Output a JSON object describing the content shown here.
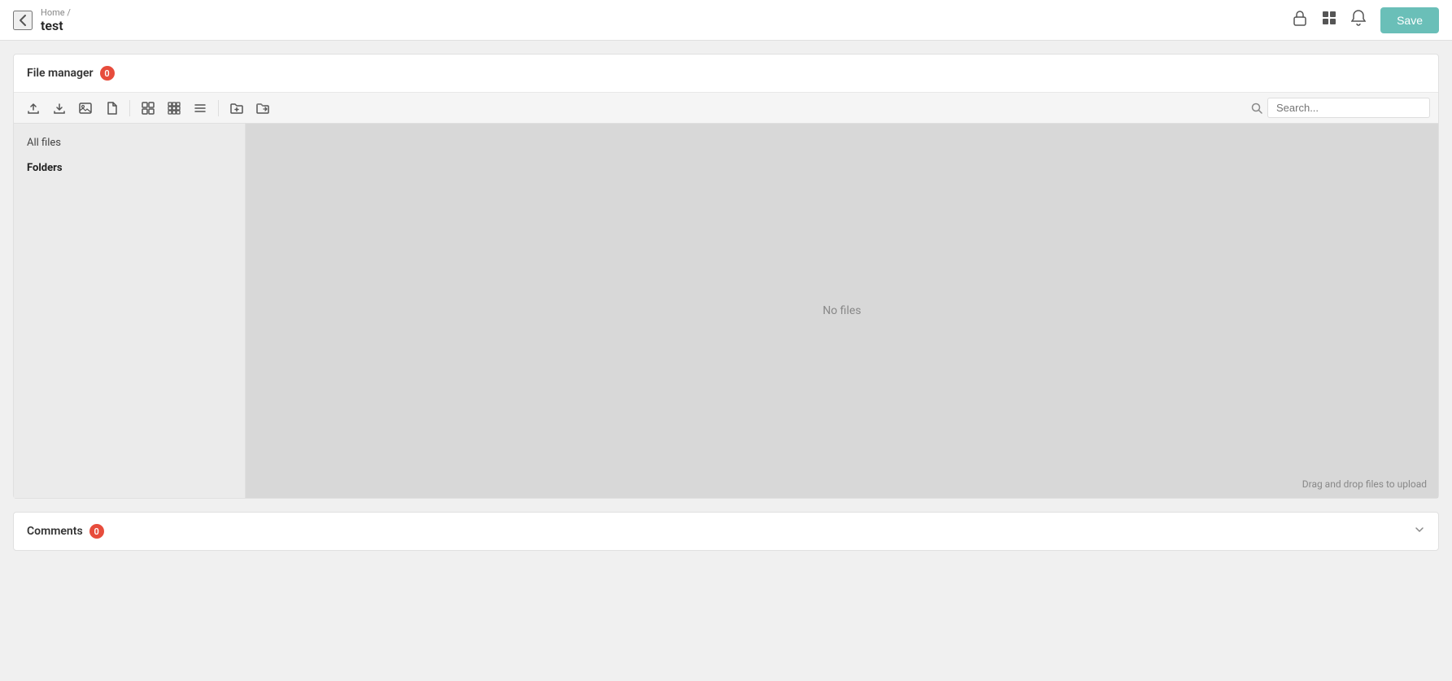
{
  "header": {
    "breadcrumb_home": "Home",
    "breadcrumb_separator": "/",
    "page_title": "test",
    "save_label": "Save",
    "back_icon": "←",
    "lock_icon": "🔒",
    "grid_icon": "⊞",
    "bell_icon": "🔔"
  },
  "file_manager": {
    "title": "File manager",
    "badge_count": "0",
    "toolbar": {
      "upload_title": "Upload",
      "export_title": "Export",
      "image_title": "Image",
      "file_title": "File",
      "grid_large_title": "Grid large",
      "grid_medium_title": "Grid medium",
      "list_title": "List",
      "new_folder_title": "New folder",
      "move_title": "Move"
    },
    "search_placeholder": "Search...",
    "sidebar": {
      "items": [
        {
          "label": "All files",
          "active": false
        },
        {
          "label": "Folders",
          "active": true
        }
      ]
    },
    "empty_text": "No files",
    "drag_drop_hint": "Drag and drop files to upload"
  },
  "comments": {
    "title": "Comments",
    "badge_count": "0"
  }
}
